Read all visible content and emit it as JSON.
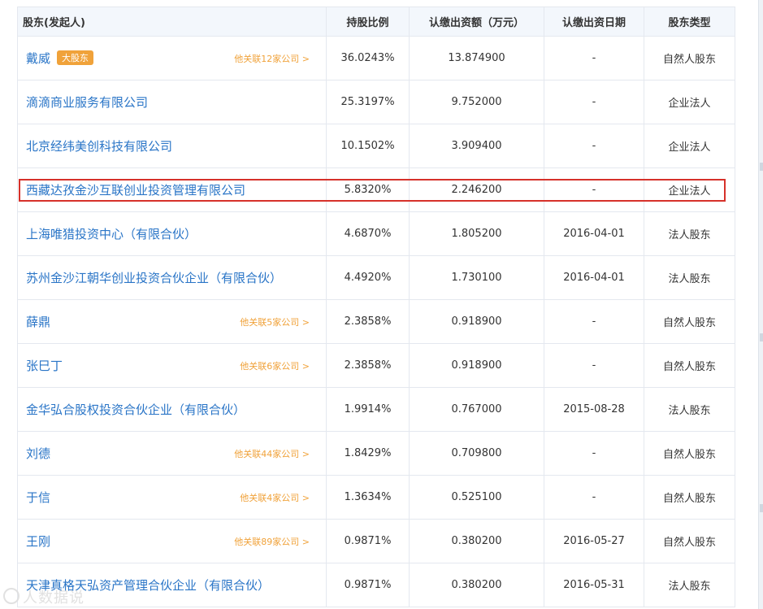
{
  "headers": {
    "name": "股东(发起人)",
    "ratio": "持股比例",
    "capital": "认缴出资额（万元）",
    "date": "认缴出资日期",
    "type": "股东类型"
  },
  "rows": [
    {
      "name": "戴威",
      "badge": "大股东",
      "related": "他关联12家公司 >",
      "ratio": "36.0243%",
      "capital": "13.874900",
      "date": "-",
      "type": "自然人股东"
    },
    {
      "name": "滴滴商业服务有限公司",
      "badge": "",
      "related": "",
      "ratio": "25.3197%",
      "capital": "9.752000",
      "date": "-",
      "type": "企业法人"
    },
    {
      "name": "北京经纬美创科技有限公司",
      "badge": "",
      "related": "",
      "ratio": "10.1502%",
      "capital": "3.909400",
      "date": "-",
      "type": "企业法人"
    },
    {
      "name": "西藏达孜金沙互联创业投资管理有限公司",
      "badge": "",
      "related": "",
      "ratio": "5.8320%",
      "capital": "2.246200",
      "date": "-",
      "type": "企业法人"
    },
    {
      "name": "上海唯猎投资中心（有限合伙）",
      "badge": "",
      "related": "",
      "ratio": "4.6870%",
      "capital": "1.805200",
      "date": "2016-04-01",
      "type": "法人股东"
    },
    {
      "name": "苏州金沙江朝华创业投资合伙企业（有限合伙）",
      "badge": "",
      "related": "",
      "ratio": "4.4920%",
      "capital": "1.730100",
      "date": "2016-04-01",
      "type": "法人股东"
    },
    {
      "name": "薛鼎",
      "badge": "",
      "related": "他关联5家公司 >",
      "ratio": "2.3858%",
      "capital": "0.918900",
      "date": "-",
      "type": "自然人股东"
    },
    {
      "name": "张巳丁",
      "badge": "",
      "related": "他关联6家公司 >",
      "ratio": "2.3858%",
      "capital": "0.918900",
      "date": "-",
      "type": "自然人股东"
    },
    {
      "name": "金华弘合股权投资合伙企业（有限合伙）",
      "badge": "",
      "related": "",
      "ratio": "1.9914%",
      "capital": "0.767000",
      "date": "2015-08-28",
      "type": "法人股东"
    },
    {
      "name": "刘德",
      "badge": "",
      "related": "他关联44家公司 >",
      "ratio": "1.8429%",
      "capital": "0.709800",
      "date": "-",
      "type": "自然人股东"
    },
    {
      "name": "于信",
      "badge": "",
      "related": "他关联4家公司 >",
      "ratio": "1.3634%",
      "capital": "0.525100",
      "date": "-",
      "type": "自然人股东"
    },
    {
      "name": "王刚",
      "badge": "",
      "related": "他关联89家公司 >",
      "ratio": "0.9871%",
      "capital": "0.380200",
      "date": "2016-05-27",
      "type": "自然人股东"
    },
    {
      "name": "天津真格天弘资产管理合伙企业（有限合伙）",
      "badge": "",
      "related": "",
      "ratio": "0.9871%",
      "capital": "0.380200",
      "date": "2016-05-31",
      "type": "法人股东"
    }
  ],
  "watermark": "人数据说",
  "colors": {
    "link": "#2a75c7",
    "badge": "#f0a23a",
    "highlight": "#d6312a",
    "header_bg": "#f3f7fc"
  }
}
